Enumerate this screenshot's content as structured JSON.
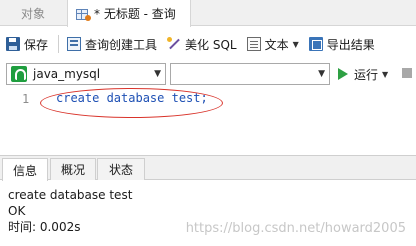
{
  "tabs": {
    "objects_label": "对象",
    "active_label": "* 无标题 - 查询"
  },
  "toolbar": {
    "save_label": "保存",
    "query_builder_label": "查询创建工具",
    "beautify_label": "美化 SQL",
    "text_label": "文本",
    "export_label": "导出结果"
  },
  "selectors": {
    "connection_value": "java_mysql",
    "database_value": "",
    "run_label": "运行"
  },
  "editor": {
    "line_number": "1",
    "code": "create database test;"
  },
  "result_tabs": {
    "info": "信息",
    "profile": "概况",
    "status": "状态"
  },
  "output": {
    "line1": "create database test",
    "line2": "OK",
    "line3": "时间: 0.002s"
  },
  "watermark": "https://blog.csdn.net/howard2005",
  "icons": {
    "tab_icon": "query-grid-icon",
    "save": "save-icon",
    "builder": "query-builder-icon",
    "beautify": "beautify-wand-icon",
    "text": "text-document-icon",
    "export": "export-icon",
    "connection": "mysql-connection-icon",
    "run": "run-play-icon",
    "stop": "stop-icon"
  },
  "colors": {
    "code_keyword": "#1e50b4",
    "annotation": "#d9342b",
    "run_green": "#2ea043",
    "connection_green": "#1f9e3f"
  }
}
